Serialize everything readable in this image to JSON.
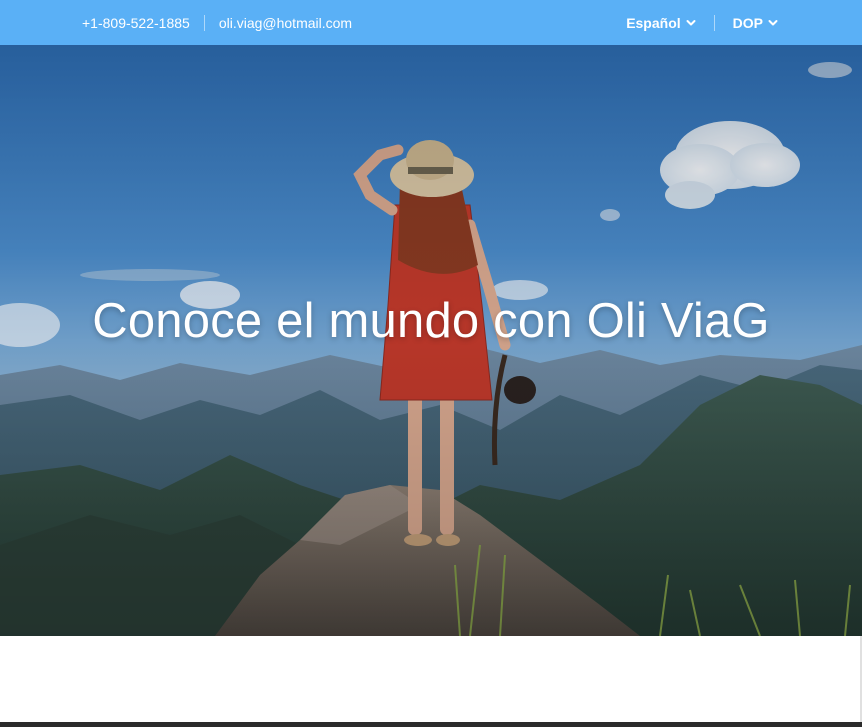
{
  "topbar": {
    "phone": "+1-809-522-1885",
    "email": "oli.viag@hotmail.com",
    "language": "Español",
    "currency": "DOP",
    "bg_color": "#5ab0f6"
  },
  "hero": {
    "title": "Conoce el mundo con Oli ViaG"
  },
  "icons": {
    "language_chevron": "chevron-down-icon",
    "currency_chevron": "chevron-down-icon"
  }
}
